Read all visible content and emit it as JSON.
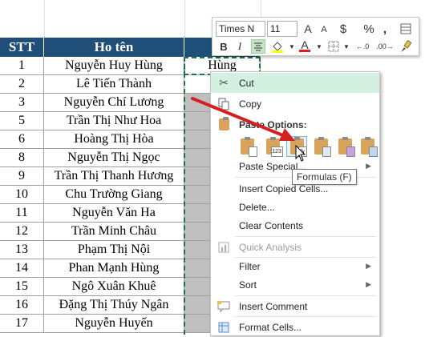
{
  "header": {
    "stt": "STT",
    "name": "Ho tên"
  },
  "rows": [
    {
      "stt": "1",
      "name": "Nguyễn Huy Hùng",
      "val": "Hùng"
    },
    {
      "stt": "2",
      "name": "Lê Tiến Thành",
      "val": ""
    },
    {
      "stt": "3",
      "name": "Nguyễn Chí Lương",
      "val": ""
    },
    {
      "stt": "5",
      "name": "Trần Thị Như Hoa",
      "val": ""
    },
    {
      "stt": "6",
      "name": "Hoàng Thị Hòa",
      "val": ""
    },
    {
      "stt": "8",
      "name": "Nguyễn Thị Ngọc",
      "val": ""
    },
    {
      "stt": "9",
      "name": "Trần Thị Thanh Hương",
      "val": ""
    },
    {
      "stt": "10",
      "name": "Chu Trường Giang",
      "val": ""
    },
    {
      "stt": "11",
      "name": "Nguyễn Văn Ha",
      "val": ""
    },
    {
      "stt": "12",
      "name": "Trần Minh Châu",
      "val": ""
    },
    {
      "stt": "13",
      "name": "Phạm Thị Nội",
      "val": ""
    },
    {
      "stt": "14",
      "name": "Phan Mạnh Hùng",
      "val": ""
    },
    {
      "stt": "15",
      "name": "Ngô  Xuân Khuê",
      "val": ""
    },
    {
      "stt": "16",
      "name": "Đặng Thị Thúy Ngân",
      "val": ""
    },
    {
      "stt": "17",
      "name": "Nguyễn Huyến",
      "val": ""
    }
  ],
  "mini_toolbar": {
    "font_name": "Times N",
    "font_size": "11",
    "grow_font": "A",
    "shrink_font": "A",
    "currency": "$",
    "percent": "%",
    "comma": ",",
    "bold": "B",
    "italic": "I",
    "font_color_letter": "A",
    "inc_decimal": "←.0",
    "dec_decimal": ".00→"
  },
  "context_menu": {
    "cut": "Cut",
    "copy": "Copy",
    "paste_options": "Paste Options:",
    "paste_special": "Paste Special...",
    "insert_copied": "Insert Copied Cells...",
    "delete": "Delete...",
    "clear_contents": "Clear Contents",
    "quick_analysis": "Quick Analysis",
    "filter": "Filter",
    "sort": "Sort",
    "insert_comment": "Insert Comment",
    "format_cells": "Format Cells...",
    "paste_icon_labels": [
      "",
      "123",
      "fx",
      "",
      "",
      ""
    ]
  },
  "tooltip": "Formulas (F)",
  "colors": {
    "header_bg": "#1f4e78",
    "highlight": "#d3f0e0",
    "arrow": "#d42020",
    "fill": "#bfbfbf"
  }
}
